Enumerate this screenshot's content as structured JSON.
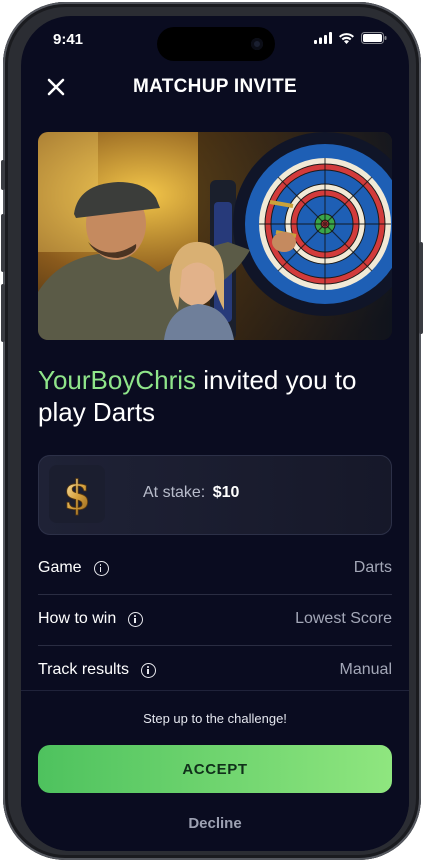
{
  "status_bar": {
    "time": "9:41",
    "icons": [
      "signal-icon",
      "wifi-icon",
      "battery-icon"
    ]
  },
  "header": {
    "title": "MATCHUP INVITE",
    "close_icon": "close-icon"
  },
  "hero": {
    "icon": "darts-photo"
  },
  "invite": {
    "inviter": "YourBoyChris",
    "message": " invited you to play Darts"
  },
  "stake": {
    "label": "At stake:",
    "amount": "$10",
    "icon": "dollar-icon"
  },
  "details": [
    {
      "label": "Game",
      "value": "Darts"
    },
    {
      "label": "How to win",
      "value": "Lowest Score"
    },
    {
      "label": "Track results",
      "value": "Manual"
    }
  ],
  "footer": {
    "tagline": "Step up to the challenge!",
    "accept_label": "ACCEPT",
    "decline_label": "Decline"
  },
  "colors": {
    "background": "#0a0c20",
    "accent": "#8fe58a",
    "button_start": "#4ec25e",
    "button_end": "#8fe67f"
  }
}
